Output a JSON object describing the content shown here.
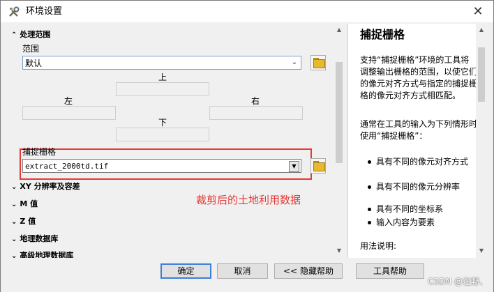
{
  "window": {
    "title": "环境设置",
    "close_glyph": "✕"
  },
  "left": {
    "processing_extent": {
      "header": "处理范围",
      "extent_label": "范围",
      "extent_value": "默认",
      "top_label": "上",
      "left_label": "左",
      "right_label": "右",
      "bottom_label": "下"
    },
    "snap_raster": {
      "label": "捕捉栅格",
      "value": "extract_2000td.tif"
    },
    "annotation": "裁剪后的土地利用数据",
    "sections": [
      {
        "label": "XY 分辨率及容差"
      },
      {
        "label": "M 值"
      },
      {
        "label": "Z 值"
      },
      {
        "label": "地理数据库"
      },
      {
        "label": "高级地理数据库"
      }
    ]
  },
  "help": {
    "title": "捕捉栅格",
    "para1": "支持“捕捉栅格”环境的工具将调整输出栅格的范围，以使它们的像元对齐方式与指定的捕捉栅格的像元对齐方式相匹配。",
    "para2": "通常在工具的输入为下列情形时使用“捕捉栅格”：",
    "bullets": [
      "具有不同的像元对齐方式",
      "具有不同的像元分辨率",
      "具有不同的坐标系",
      "输入内容为要素"
    ],
    "usage": "用法说明:"
  },
  "buttons": {
    "ok": "确定",
    "cancel": "取消",
    "hide_help": "<< 隐藏帮助",
    "tool_help": "工具帮助"
  },
  "watermark": "CSDN @在野、",
  "icons": {
    "title": "tools-icon",
    "folder": "open-folder-icon",
    "collapse": "double-chevron-up-icon",
    "expand": "double-chevron-down-icon"
  }
}
